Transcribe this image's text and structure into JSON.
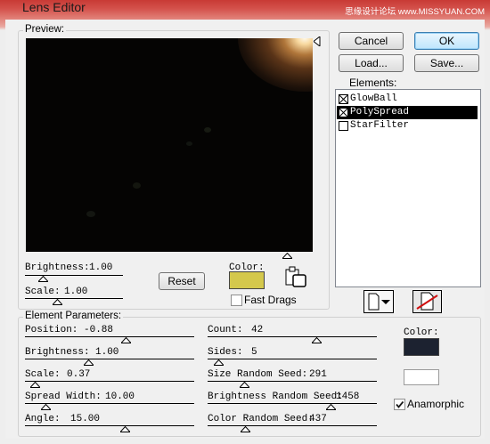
{
  "window": {
    "title": "Lens Editor",
    "watermark": "思缘设计论坛 www.MISSYUAN.COM"
  },
  "preview": {
    "label": "Preview:",
    "brightness_label": "Brightness:",
    "brightness_value": "1.00",
    "scale_label": "Scale:",
    "scale_value": "1.00",
    "reset_label": "Reset",
    "color_label": "Color:",
    "color_hex": "#d4c84c",
    "fast_drags_label": "Fast Drags",
    "fast_drags_checked": false
  },
  "buttons": {
    "cancel": "Cancel",
    "ok": "OK",
    "load": "Load...",
    "save": "Save..."
  },
  "elements": {
    "label": "Elements:",
    "items": [
      {
        "name": "GlowBall",
        "checked": true,
        "selected": false
      },
      {
        "name": "PolySpread",
        "checked": true,
        "selected": true
      },
      {
        "name": "StarFilter",
        "checked": false,
        "selected": false
      }
    ]
  },
  "params": {
    "label": "Element Parameters:",
    "left": [
      {
        "label": "Position:",
        "value": "-0.88"
      },
      {
        "label": "Brightness:",
        "value": "1.00"
      },
      {
        "label": "Scale:",
        "value": "0.37"
      },
      {
        "label": "Spread Width:",
        "value": "10.00"
      },
      {
        "label": "Angle:",
        "value": "15.00"
      }
    ],
    "right": [
      {
        "label": "Count:",
        "value": "42"
      },
      {
        "label": "Sides:",
        "value": "5"
      },
      {
        "label": "Size Random Seed:",
        "value": "291"
      },
      {
        "label": "Brightness Random Seed:",
        "value": "1458"
      },
      {
        "label": "Color Random Seed:",
        "value": "437"
      }
    ],
    "color_label": "Color:",
    "color_hex": "#1c2230",
    "color2_hex": "#ffffff",
    "anamorphic_label": "Anamorphic",
    "anamorphic_checked": true
  },
  "colors": {
    "titlebar": "#c83a35",
    "selection": "#000000"
  }
}
